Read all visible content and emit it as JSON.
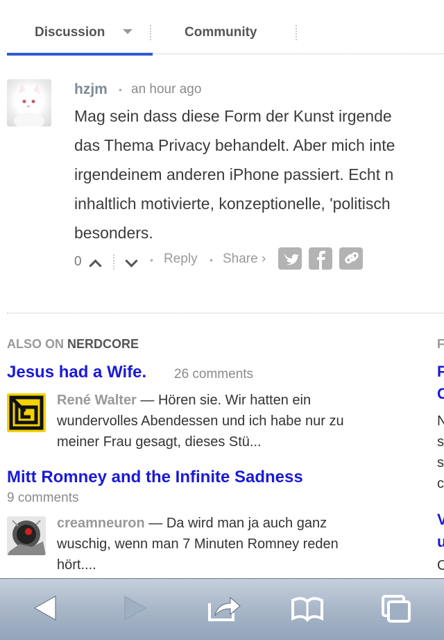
{
  "tabs": {
    "discussion": "Discussion",
    "community": "Community"
  },
  "comment": {
    "author": "hzjm",
    "time": "an hour ago",
    "lines": [
      "Mag sein dass diese Form der Kunst irgende",
      "das Thema Privacy behandelt. Aber mich inte",
      "irgendeinem anderen iPhone passiert. Echt n",
      "inhaltlich motivierte, konzeptionelle, 'politisch",
      "besonders."
    ],
    "votes": "0",
    "reply": "Reply",
    "share": "Share ›",
    "share_icons": [
      "twitter-icon",
      "facebook-icon",
      "link-icon"
    ]
  },
  "also_on": {
    "prefix": "ALSO ON",
    "site": "NERDCORE",
    "right_prefix": "F",
    "items": [
      {
        "title": "Jesus had a Wife.",
        "count": "26 comments",
        "author": "René Walter",
        "dash": " — ",
        "snippet_lines": [
          "Hören sie. Wir hatten ein",
          "wundervolles Abendessen und ich habe nur zu",
          "meiner Frau gesagt, dieses Stü..."
        ]
      },
      {
        "title": "Mitt Romney and the Infinite Sadness",
        "count": "9 comments",
        "author": "creamneuron",
        "dash": " — ",
        "snippet_lines": [
          "Da wird man ja auch ganz",
          "wuschig, wenn man 7 Minuten Romney reden",
          "hört...."
        ]
      }
    ],
    "right_column_fragments": [
      "F",
      "C",
      "N",
      "s",
      "s",
      "c",
      "V",
      "u",
      "C"
    ]
  },
  "toolbar": {
    "icons": [
      "back-icon",
      "forward-icon",
      "share-icon",
      "bookmarks-icon",
      "tabs-icon"
    ]
  },
  "colors": {
    "link": "#1a1ad6",
    "tab_accent": "#2e5bd6",
    "toolbar": "#a8b6c8"
  }
}
